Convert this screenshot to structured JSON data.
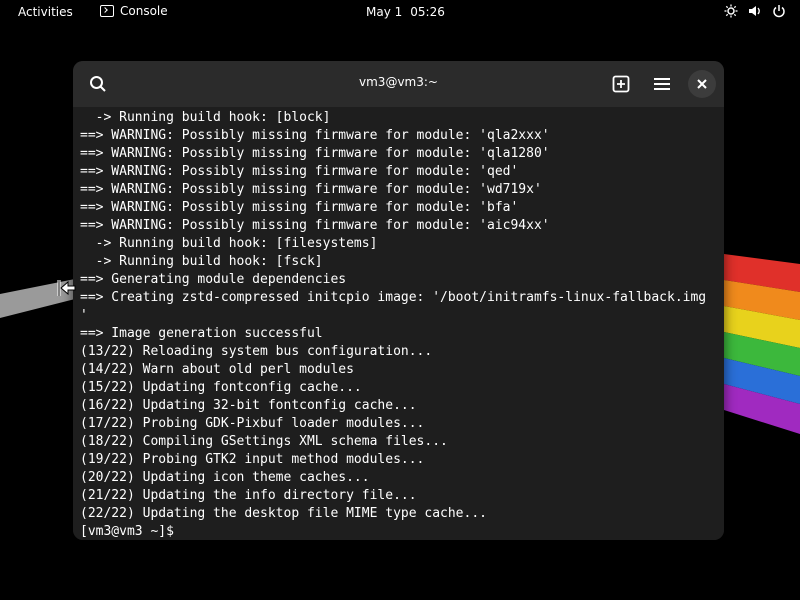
{
  "topbar": {
    "activities": "Activities",
    "app_name": "Console",
    "clock_date": "May 1",
    "clock_time": "05:26"
  },
  "icons": {
    "app": "console-icon",
    "brightness": "brightness-icon",
    "volume": "volume-icon",
    "power": "power-icon",
    "search": "search-icon",
    "new_tab": "new-tab-icon",
    "menu": "hamburger-menu-icon",
    "close": "close-icon",
    "cursor": "resize-cursor-icon"
  },
  "window": {
    "title": "vm3@vm3:~"
  },
  "terminal": {
    "lines": [
      "  -> Running build hook: [block]",
      "==> WARNING: Possibly missing firmware for module: 'qla2xxx'",
      "==> WARNING: Possibly missing firmware for module: 'qla1280'",
      "==> WARNING: Possibly missing firmware for module: 'qed'",
      "==> WARNING: Possibly missing firmware for module: 'wd719x'",
      "==> WARNING: Possibly missing firmware for module: 'bfa'",
      "==> WARNING: Possibly missing firmware for module: 'aic94xx'",
      "  -> Running build hook: [filesystems]",
      "  -> Running build hook: [fsck]",
      "==> Generating module dependencies",
      "==> Creating zstd-compressed initcpio image: '/boot/initramfs-linux-fallback.img",
      "'",
      "==> Image generation successful",
      "(13/22) Reloading system bus configuration...",
      "(14/22) Warn about old perl modules",
      "(15/22) Updating fontconfig cache...",
      "(16/22) Updating 32-bit fontconfig cache...",
      "(17/22) Probing GDK-Pixbuf loader modules...",
      "(18/22) Compiling GSettings XML schema files...",
      "(19/22) Probing GTK2 input method modules...",
      "(20/22) Updating icon theme caches...",
      "(21/22) Updating the info directory file...",
      "(22/22) Updating the desktop file MIME type cache...",
      "[vm3@vm3 ~]$ "
    ]
  },
  "colors": {
    "desktop_bg": "#000000",
    "window_bg": "#1e1e1e",
    "headerbar_bg": "#2b2b2b",
    "text": "#ffffff"
  }
}
